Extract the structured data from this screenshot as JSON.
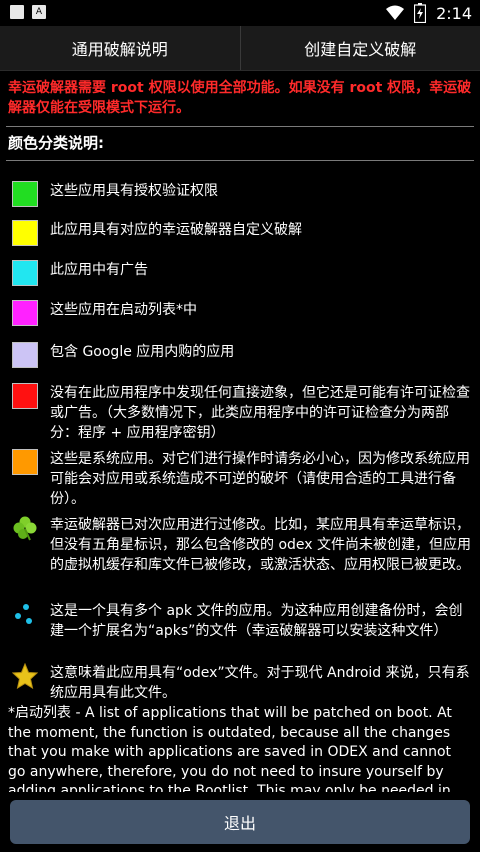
{
  "status_bar": {
    "time": "2:14",
    "left_icons": [
      "notification-square-icon",
      "app-a-icon"
    ],
    "right_icons": [
      "wifi-icon",
      "battery-charging-icon"
    ]
  },
  "tabs": [
    {
      "label": "通用破解说明"
    },
    {
      "label": "创建自定义破解"
    }
  ],
  "warning": "幸运破解器需要 root 权限以使用全部功能。如果没有 root 权限，幸运破解器仅能在受限模式下运行。",
  "section_title": "颜色分类说明:",
  "legend": [
    {
      "kind": "swatch",
      "color": "#22dd22",
      "text": "这些应用具有授权验证权限"
    },
    {
      "kind": "swatch",
      "color": "#ffff00",
      "text": "此应用具有对应的幸运破解器自定义破解"
    },
    {
      "kind": "swatch",
      "color": "#22e6f0",
      "text": "此应用中有广告"
    },
    {
      "kind": "swatch",
      "color": "#ff22ff",
      "text": "这些应用在启动列表*中"
    },
    {
      "kind": "swatch",
      "color": "#ccc4f5",
      "text": "包含 Google 应用内购的应用"
    },
    {
      "kind": "swatch",
      "color": "#ff1111",
      "text": "没有在此应用程序中发现任何直接迹象，但它还是可能有许可证检查或广告。（大多数情况下，此类应用程序中的许可证检查分为两部分：程序 + 应用程序密钥）"
    },
    {
      "kind": "swatch",
      "color": "#ff9900",
      "text": "这些是系统应用。对它们进行操作时请务必小心，因为修改系统应用可能会对应用或系统造成不可逆的破坏（请使用合适的工具进行备份）。"
    },
    {
      "kind": "icon",
      "icon": "clover-icon",
      "text": "幸运破解器已对次应用进行过修改。比如，某应用具有幸运草标识，但没有五角星标识，那么包含修改的 odex 文件尚未被创建，但应用的虚拟机缓存和库文件已被修改，或激活状态、应用权限已被更改。"
    },
    {
      "kind": "icon",
      "icon": "multi-apk-dots-icon",
      "text": "这是一个具有多个 apk 文件的应用。为这种应用创建备份时，会创建一个扩展名为“apks”的文件（幸运破解器可以安装这种文件）"
    },
    {
      "kind": "icon",
      "icon": "star-icon",
      "text": "这意味着此应用具有“odex”文件。对于现代 Android 来说，只有系统应用具有此文件。"
    }
  ],
  "bootlist_note": "*启动列表 - A list of applications that will be patched on boot. At the moment, the function is outdated, because all the changes that you make with applications are saved in ODEX and cannot go anywhere, therefore, you do not need to insure yourself by adding applications to the Bootlist. This may only be needed in case, if a custom patch",
  "exit_button": "退出"
}
